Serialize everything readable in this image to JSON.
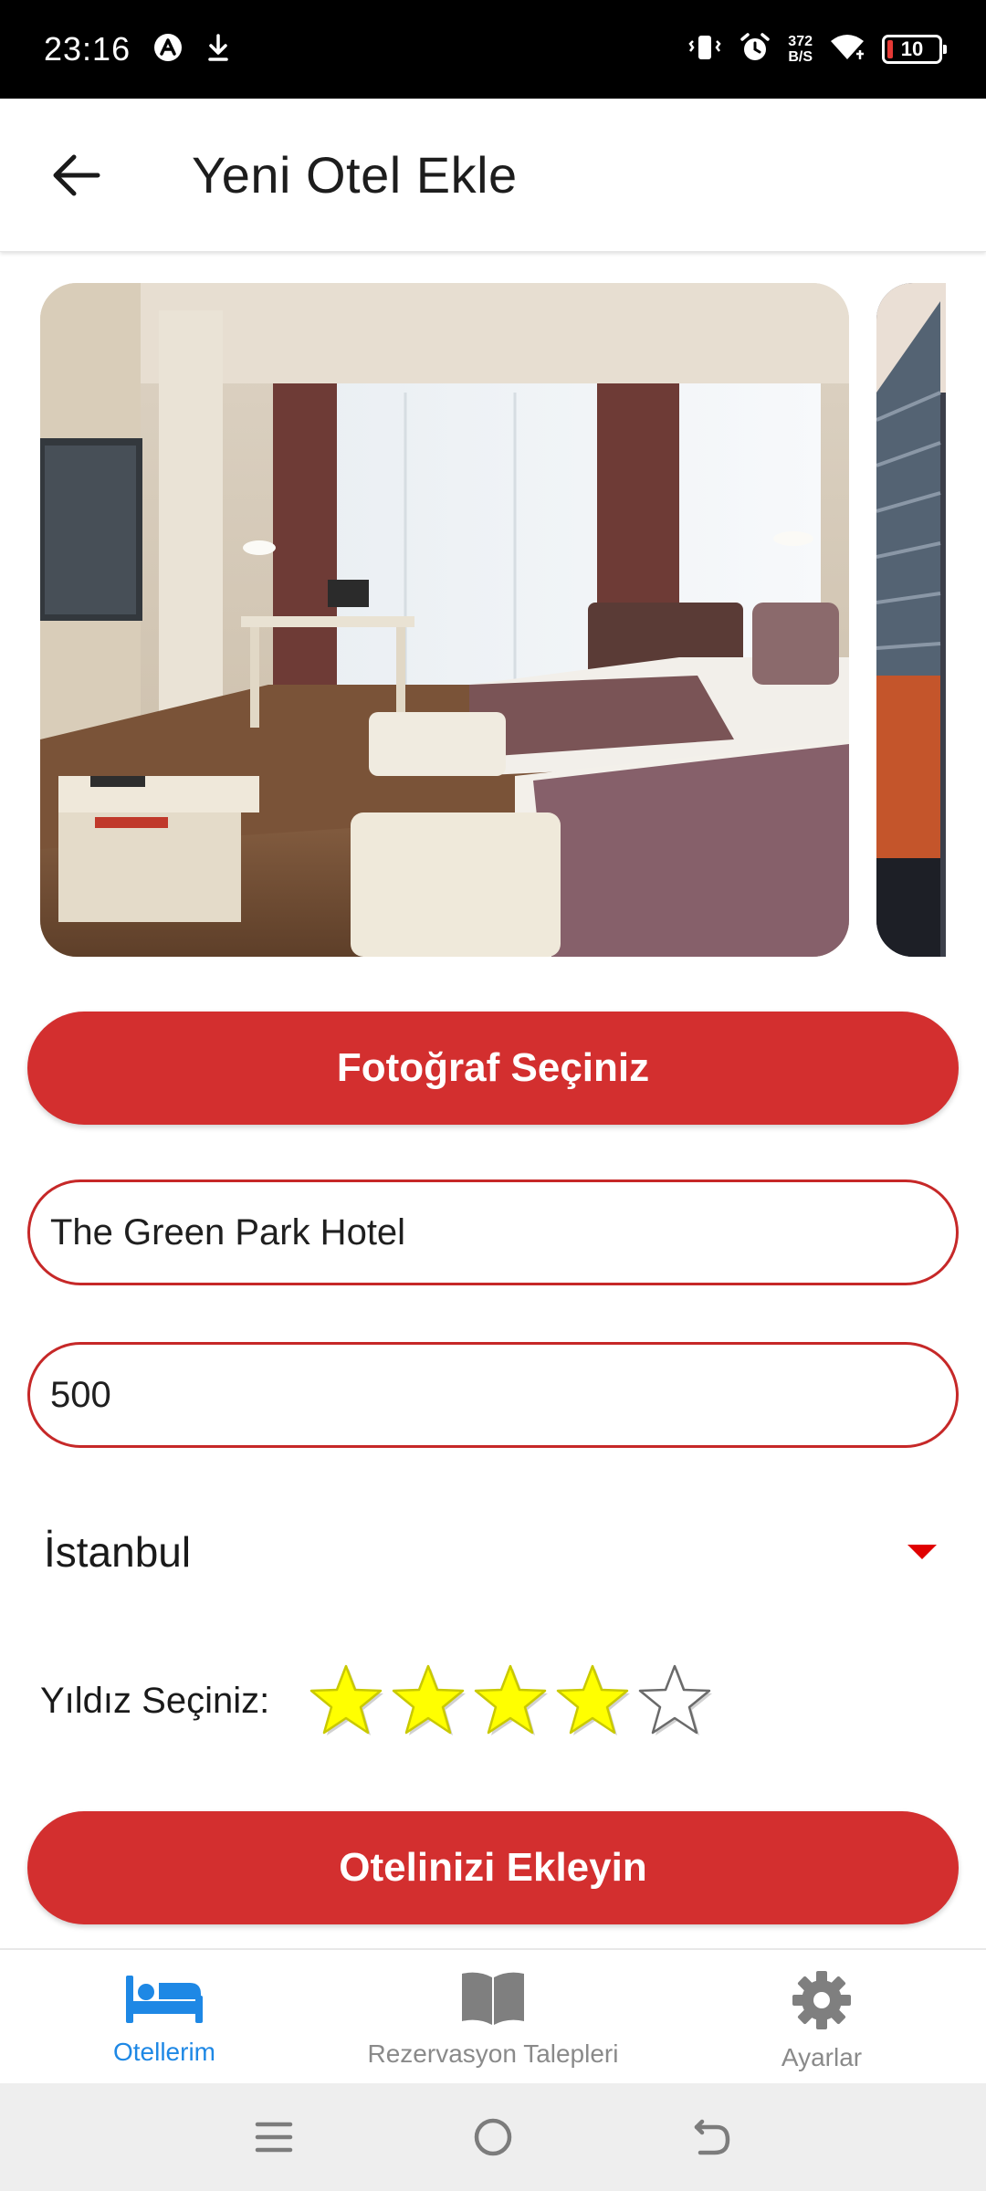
{
  "status_bar": {
    "time": "23:16",
    "net_speed_value": "372",
    "net_speed_unit": "B/S",
    "battery_level": "10",
    "icons": [
      "app-notification-icon",
      "download-icon",
      "vibrate-icon",
      "alarm-icon",
      "wifi-icon",
      "battery-icon"
    ]
  },
  "app_bar": {
    "title": "Yeni Otel Ekle",
    "back_icon": "arrow-left-icon"
  },
  "gallery": {
    "photos": [
      "hotel-room-photo",
      "hotel-exterior-photo"
    ]
  },
  "form": {
    "select_photo_button": "Fotoğraf Seçiniz",
    "hotel_name_value": "The Green Park Hotel",
    "price_value": "500",
    "city_selected": "İstanbul",
    "rating_label": "Yıldız Seçiniz:",
    "rating_value": 4,
    "rating_max": 5,
    "submit_button": "Otelinizi Ekleyin"
  },
  "bottom_nav": {
    "items": [
      {
        "label": "Otellerim",
        "icon": "bed-icon",
        "active": true
      },
      {
        "label": "Rezervasyon Talepleri",
        "icon": "book-icon",
        "active": false
      },
      {
        "label": "Ayarlar",
        "icon": "gear-icon",
        "active": false
      }
    ]
  },
  "system_nav": {
    "buttons": [
      "menu-icon",
      "home-icon",
      "back-icon"
    ]
  },
  "colors": {
    "accent": "#d32f2f",
    "active_nav": "#1e88e5",
    "star_fill": "#ffff00",
    "inactive_nav": "#8a8a8a"
  }
}
